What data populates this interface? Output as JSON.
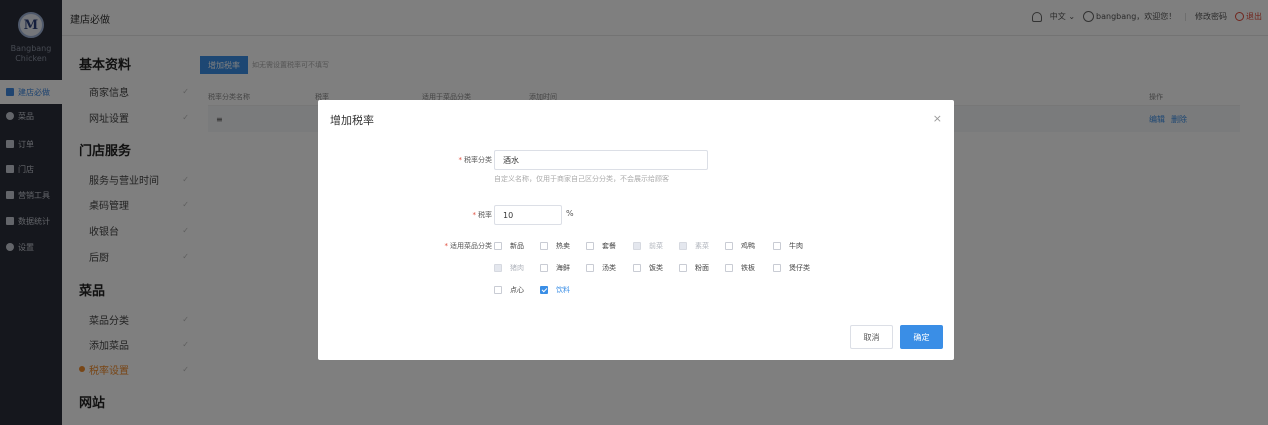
{
  "sidebar": {
    "logo_letter": "M",
    "brand_line1": "Bangbang",
    "brand_line2": "Chicken",
    "items": [
      {
        "label": "建店必做",
        "icon": "book-icon",
        "active": true
      },
      {
        "label": "菜品",
        "icon": "dish-icon",
        "active": false
      },
      {
        "label": "订单",
        "icon": "fork-knife-icon",
        "active": false
      },
      {
        "label": "门店",
        "icon": "store-icon",
        "active": false
      },
      {
        "label": "营销工具",
        "icon": "marketing-icon",
        "active": false
      },
      {
        "label": "数据统计",
        "icon": "chart-icon",
        "active": false
      },
      {
        "label": "设置",
        "icon": "gear-icon",
        "active": false
      }
    ]
  },
  "header": {
    "title": "建店必做",
    "language": "中文",
    "welcome": "bangbang，欢迎您！",
    "change_password": "修改密码",
    "logout": "退出"
  },
  "subnav": {
    "sections": [
      {
        "title": "基本资料",
        "items": [
          "商家信息",
          "网址设置"
        ]
      },
      {
        "title": "门店服务",
        "items": [
          "服务与营业时间",
          "桌码管理",
          "收银台",
          "后厨"
        ]
      },
      {
        "title": "菜品",
        "items": [
          "菜品分类",
          "添加菜品",
          "税率设置"
        ]
      },
      {
        "title": "网站",
        "items": []
      }
    ],
    "active_item": "税率设置"
  },
  "main": {
    "add_button": "增加税率",
    "hint": "如无需设置税率可不填写",
    "columns": [
      "税率分类名称",
      "税率",
      "适用于菜品分类",
      "添加时间",
      "操作"
    ],
    "row": {
      "name": "≡",
      "edit": "编辑",
      "delete": "删除"
    }
  },
  "modal": {
    "title": "增加税率",
    "category_label": "税率分类",
    "category_value": "酒水",
    "category_hint": "自定义名称，仅用于商家自己区分分类，不会展示给顾客",
    "rate_label": "税率",
    "rate_value": "10",
    "rate_unit": "%",
    "applies_label": "适用菜品分类",
    "dish_categories": [
      {
        "label": "新品",
        "checked": false,
        "disabled": false
      },
      {
        "label": "热卖",
        "checked": false,
        "disabled": false
      },
      {
        "label": "套餐",
        "checked": false,
        "disabled": false
      },
      {
        "label": "前菜",
        "checked": false,
        "disabled": true
      },
      {
        "label": "素菜",
        "checked": false,
        "disabled": true
      },
      {
        "label": "鸡鸭",
        "checked": false,
        "disabled": false
      },
      {
        "label": "牛肉",
        "checked": false,
        "disabled": false
      },
      {
        "label": "猪肉",
        "checked": false,
        "disabled": true
      },
      {
        "label": "海鲜",
        "checked": false,
        "disabled": false
      },
      {
        "label": "汤类",
        "checked": false,
        "disabled": false
      },
      {
        "label": "饭类",
        "checked": false,
        "disabled": false
      },
      {
        "label": "粉面",
        "checked": false,
        "disabled": false
      },
      {
        "label": "铁板",
        "checked": false,
        "disabled": false
      },
      {
        "label": "煲仔类",
        "checked": false,
        "disabled": false
      },
      {
        "label": "点心",
        "checked": false,
        "disabled": false
      },
      {
        "label": "饮料",
        "checked": true,
        "disabled": false
      }
    ],
    "cancel": "取消",
    "confirm": "确定",
    "close_glyph": "×"
  },
  "colors": {
    "accent": "#3a8ee6",
    "sidebar_bg": "#2b2f3a",
    "active_orange": "#f08c2c",
    "required": "#e04b3a"
  }
}
